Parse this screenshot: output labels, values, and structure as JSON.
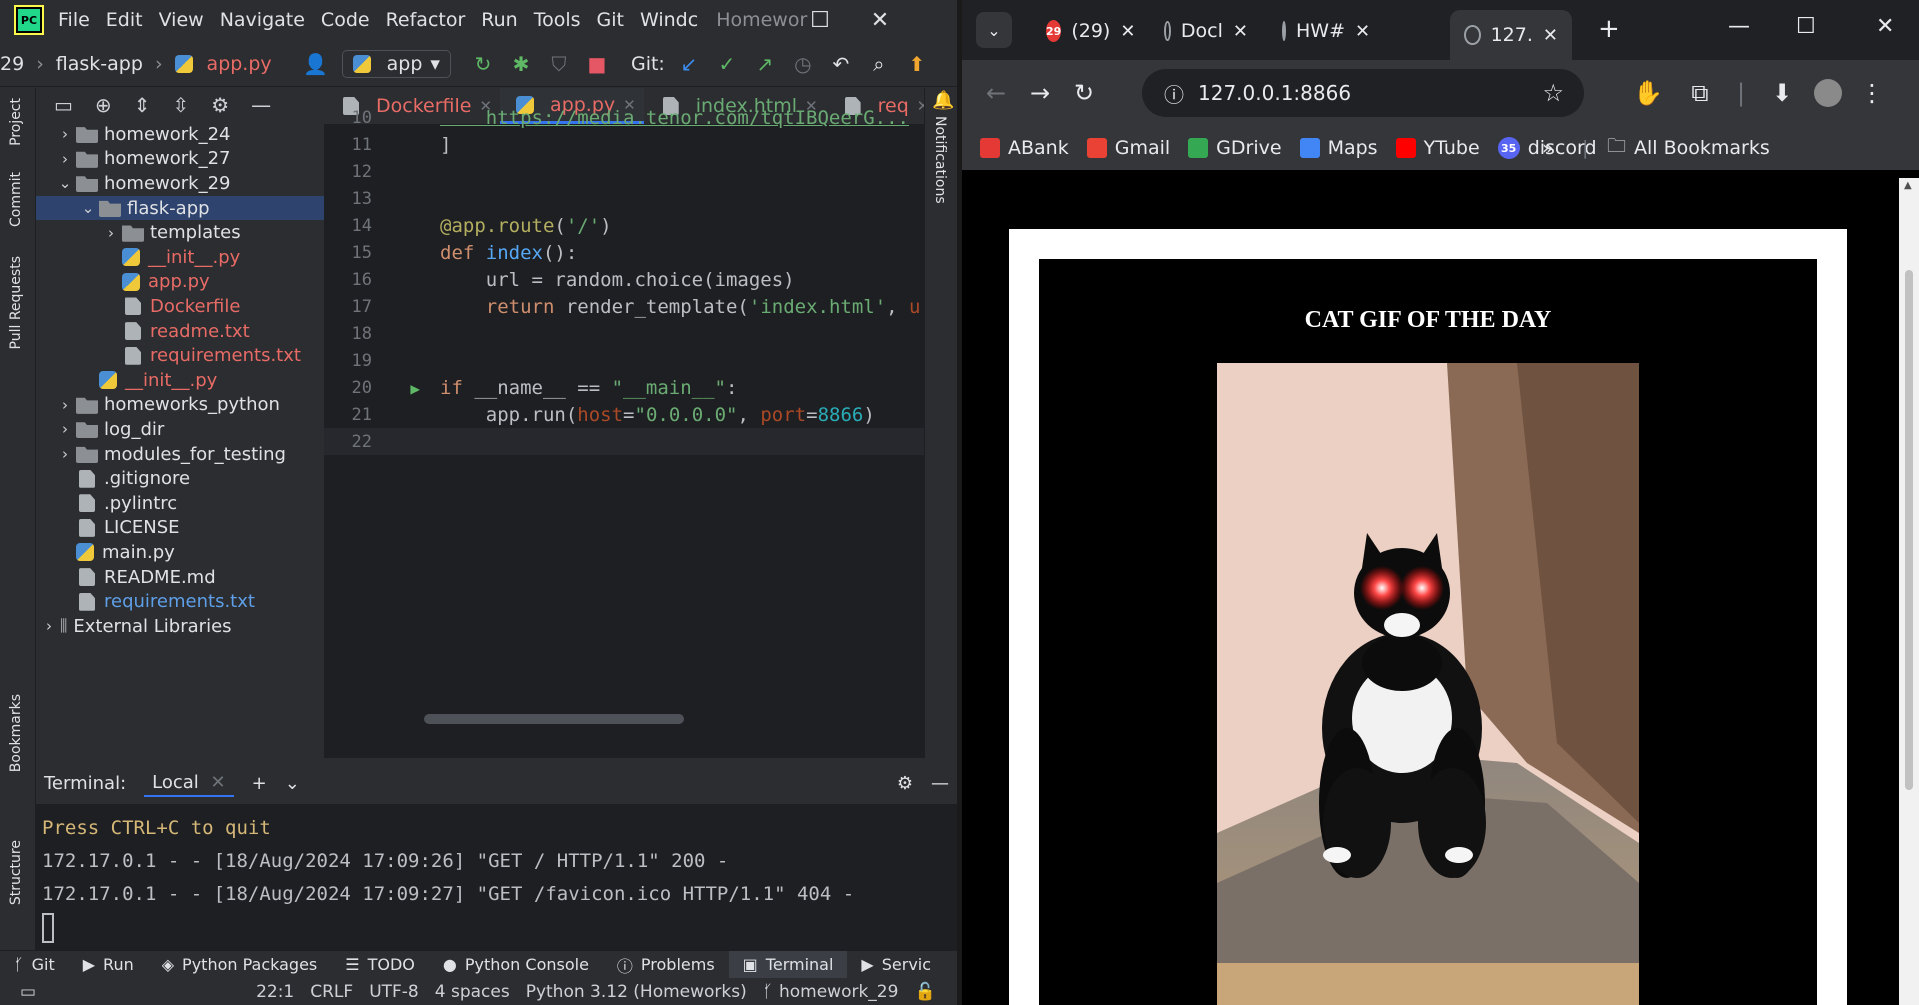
{
  "ide": {
    "logo_text": "PC",
    "menu": [
      "File",
      "Edit",
      "View",
      "Navigate",
      "Code",
      "Refactor",
      "Run",
      "Tools",
      "Git",
      "Windc"
    ],
    "project_title": "Homewor",
    "toolbar": {
      "breadcrumb_num": "29",
      "breadcrumb_folder": "flask-app",
      "breadcrumb_file": "app.py",
      "run_config": "app",
      "git_label": "Git:"
    },
    "side_tabs": [
      "Project",
      "Commit",
      "Pull Requests",
      "Bookmarks",
      "Structure"
    ],
    "right_tab": "Notifications",
    "tree": [
      {
        "name": "homework_24",
        "type": "folder",
        "depth": 0,
        "expanded": false,
        "color": "normal"
      },
      {
        "name": "homework_27",
        "type": "folder",
        "depth": 0,
        "expanded": false,
        "color": "normal"
      },
      {
        "name": "homework_29",
        "type": "folder",
        "depth": 0,
        "expanded": true,
        "color": "normal"
      },
      {
        "name": "flask-app",
        "type": "folder",
        "depth": 1,
        "expanded": true,
        "color": "normal",
        "selected": true
      },
      {
        "name": "templates",
        "type": "folder",
        "depth": 2,
        "expanded": false,
        "color": "normal"
      },
      {
        "name": "__init__.py",
        "type": "py",
        "depth": 2,
        "color": "red"
      },
      {
        "name": "app.py",
        "type": "py",
        "depth": 2,
        "color": "red"
      },
      {
        "name": "Dockerfile",
        "type": "file",
        "depth": 2,
        "color": "red"
      },
      {
        "name": "readme.txt",
        "type": "file",
        "depth": 2,
        "color": "red"
      },
      {
        "name": "requirements.txt",
        "type": "file",
        "depth": 2,
        "color": "red"
      },
      {
        "name": "__init__.py",
        "type": "py",
        "depth": 1,
        "color": "red"
      },
      {
        "name": "homeworks_python",
        "type": "folder",
        "depth": 0,
        "expanded": false,
        "color": "normal"
      },
      {
        "name": "log_dir",
        "type": "folder",
        "depth": 0,
        "expanded": false,
        "color": "normal"
      },
      {
        "name": "modules_for_testing",
        "type": "folder",
        "depth": 0,
        "expanded": false,
        "color": "normal"
      },
      {
        "name": ".gitignore",
        "type": "file",
        "depth": 0,
        "color": "normal"
      },
      {
        "name": ".pylintrc",
        "type": "file",
        "depth": 0,
        "color": "normal"
      },
      {
        "name": "LICENSE",
        "type": "file",
        "depth": 0,
        "color": "normal"
      },
      {
        "name": "main.py",
        "type": "py",
        "depth": 0,
        "color": "normal"
      },
      {
        "name": "README.md",
        "type": "file",
        "depth": 0,
        "color": "normal"
      },
      {
        "name": "requirements.txt",
        "type": "file",
        "depth": 0,
        "color": "blue"
      },
      {
        "name": "External Libraries",
        "type": "lib",
        "depth": -1,
        "expanded": false,
        "color": "normal"
      }
    ],
    "editor_tabs": [
      {
        "label": "Dockerfile",
        "color": "red",
        "active": false
      },
      {
        "label": "app.py",
        "color": "red",
        "active": true
      },
      {
        "label": "index.html",
        "color": "green",
        "active": false
      },
      {
        "label": "req",
        "color": "red",
        "active": false
      }
    ],
    "code_lines": [
      {
        "n": "10",
        "text": "    https://media.tenor.com/tqtIBQeerG...",
        "style": "url"
      },
      {
        "n": "11",
        "text": "]",
        "style": "plain"
      },
      {
        "n": "12",
        "text": "",
        "style": "plain"
      },
      {
        "n": "13",
        "text": "",
        "style": "plain"
      },
      {
        "n": "14",
        "text": "@app.route('/')",
        "style": "decorator"
      },
      {
        "n": "15",
        "text": "def index():",
        "style": "def"
      },
      {
        "n": "16",
        "text": "    url = random.choice(images)",
        "style": "plain"
      },
      {
        "n": "17",
        "text": "    return render_template('index.html', u",
        "style": "return"
      },
      {
        "n": "18",
        "text": "",
        "style": "plain"
      },
      {
        "n": "19",
        "text": "",
        "style": "plain"
      },
      {
        "n": "20",
        "text": "if __name__ == \"__main__\":",
        "style": "if"
      },
      {
        "n": "21",
        "text": "    app.run(host=\"0.0.0.0\", port=8866)",
        "style": "run"
      },
      {
        "n": "22",
        "text": "",
        "style": "current"
      }
    ],
    "terminal": {
      "label": "Terminal:",
      "tab": "Local",
      "lines": [
        "Press CTRL+C to quit",
        "172.17.0.1 - - [18/Aug/2024 17:09:26] \"GET / HTTP/1.1\" 200 -",
        "172.17.0.1 - - [18/Aug/2024 17:09:27] \"GET /favicon.ico HTTP/1.1\" 404 -"
      ]
    },
    "bottom_tools": [
      "Git",
      "Run",
      "Python Packages",
      "TODO",
      "Python Console",
      "Problems",
      "Terminal",
      "Servic"
    ],
    "status": {
      "position": "22:1",
      "line_sep": "CRLF",
      "encoding": "UTF-8",
      "indent": "4 spaces",
      "interpreter": "Python 3.12 (Homeworks)",
      "branch": "homework_29"
    }
  },
  "browser": {
    "tabs": [
      {
        "label": "(29)",
        "icon": "discord-badge",
        "badge": "29"
      },
      {
        "label": "Docl",
        "icon": "globe-icon"
      },
      {
        "label": "HW#",
        "icon": "globe-icon"
      },
      {
        "label": "127.",
        "icon": "globe-icon",
        "active": true
      }
    ],
    "url": "127.0.0.1:8866",
    "bookmarks": [
      {
        "label": "ABank",
        "color": "#e53935"
      },
      {
        "label": "Gmail",
        "color": "#ea4335"
      },
      {
        "label": "GDrive",
        "color": "#34a853"
      },
      {
        "label": "Maps",
        "color": "#4285f4"
      },
      {
        "label": "YTube",
        "color": "#ff0000"
      },
      {
        "label": "discord",
        "color": "#5865f2",
        "badge": "35"
      }
    ],
    "all_bookmarks": "All Bookmarks",
    "page": {
      "title": "CAT GIF OF THE DAY"
    }
  }
}
